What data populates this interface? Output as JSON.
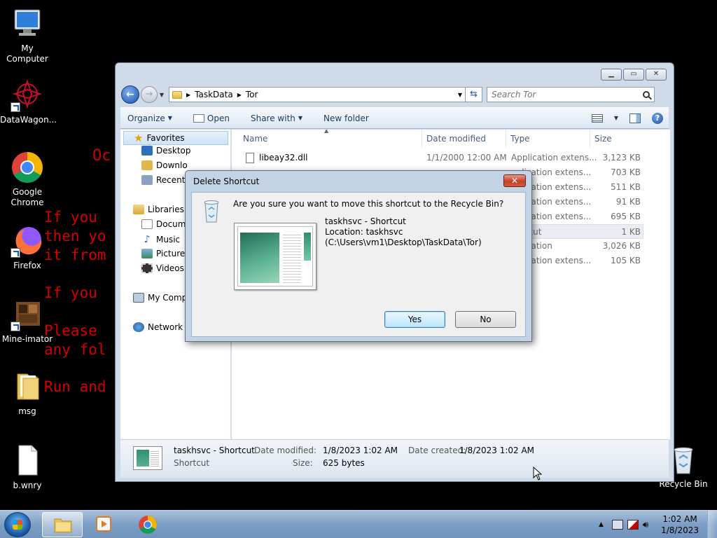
{
  "desktop": {
    "icons": [
      {
        "label": "My Computer"
      },
      {
        "label": "DataWagon..."
      },
      {
        "label": "Google Chrome"
      },
      {
        "label": "Firefox"
      },
      {
        "label": "Mine-imator"
      },
      {
        "label": "msg"
      },
      {
        "label": "b.wnry"
      },
      {
        "label": "Recycle Bin"
      }
    ],
    "ransom_text": [
      "Oc",
      "If you",
      "then yo",
      "it from",
      "If you",
      "Please",
      "any fol",
      "Run and"
    ]
  },
  "explorer": {
    "address": {
      "crumb1": "TaskData",
      "crumb2": "Tor"
    },
    "search_placeholder": "Search Tor",
    "toolbar": {
      "organize": "Organize",
      "open": "Open",
      "share_with": "Share with",
      "new_folder": "New folder"
    },
    "nav": {
      "favorites": "Favorites",
      "desktop": "Desktop",
      "downloads": "Downlo",
      "recent": "Recent P",
      "libraries": "Libraries",
      "documents": "Docume",
      "music": "Music",
      "pictures": "Pictures",
      "videos": "Videos",
      "my_computer": "My Comp",
      "network": "Network"
    },
    "columns": {
      "name": "Name",
      "date": "Date modified",
      "type": "Type",
      "size": "Size"
    },
    "rows": [
      {
        "name": "libeay32.dll",
        "date": "1/1/2000 12:00 AM",
        "type": "Application extens...",
        "size": "3,123 KB"
      },
      {
        "name": "",
        "date": "",
        "type": "pplication extens...",
        "size": "703 KB"
      },
      {
        "name": "",
        "date": "",
        "type": "pplication extens...",
        "size": "511 KB"
      },
      {
        "name": "",
        "date": "",
        "type": "pplication extens...",
        "size": "91 KB"
      },
      {
        "name": "",
        "date": "",
        "type": "pplication extens...",
        "size": "695 KB"
      },
      {
        "name": "",
        "date": "",
        "type": "hortcut",
        "size": "1 KB"
      },
      {
        "name": "",
        "date": "",
        "type": "pplication",
        "size": "3,026 KB"
      },
      {
        "name": "",
        "date": "",
        "type": "pplication extens...",
        "size": "105 KB"
      }
    ],
    "details": {
      "name": "taskhsvc - Shortcut",
      "kind": "Shortcut",
      "date_modified_label": "Date modified:",
      "date_modified": "1/8/2023 1:02 AM",
      "date_created_label": "Date created:",
      "date_created": "1/8/2023 1:02 AM",
      "size_label": "Size:",
      "size": "625 bytes"
    }
  },
  "dialog": {
    "title": "Delete Shortcut",
    "question": "Are you sure you want to move this shortcut to the Recycle Bin?",
    "item_name": "taskhsvc - Shortcut",
    "location_line": "Location: taskhsvc",
    "path_line": "(C:\\Users\\vm1\\Desktop\\TaskData\\Tor)",
    "yes": "Yes",
    "no": "No"
  },
  "taskbar": {
    "time": "1:02 AM",
    "date": "1/8/2023"
  }
}
